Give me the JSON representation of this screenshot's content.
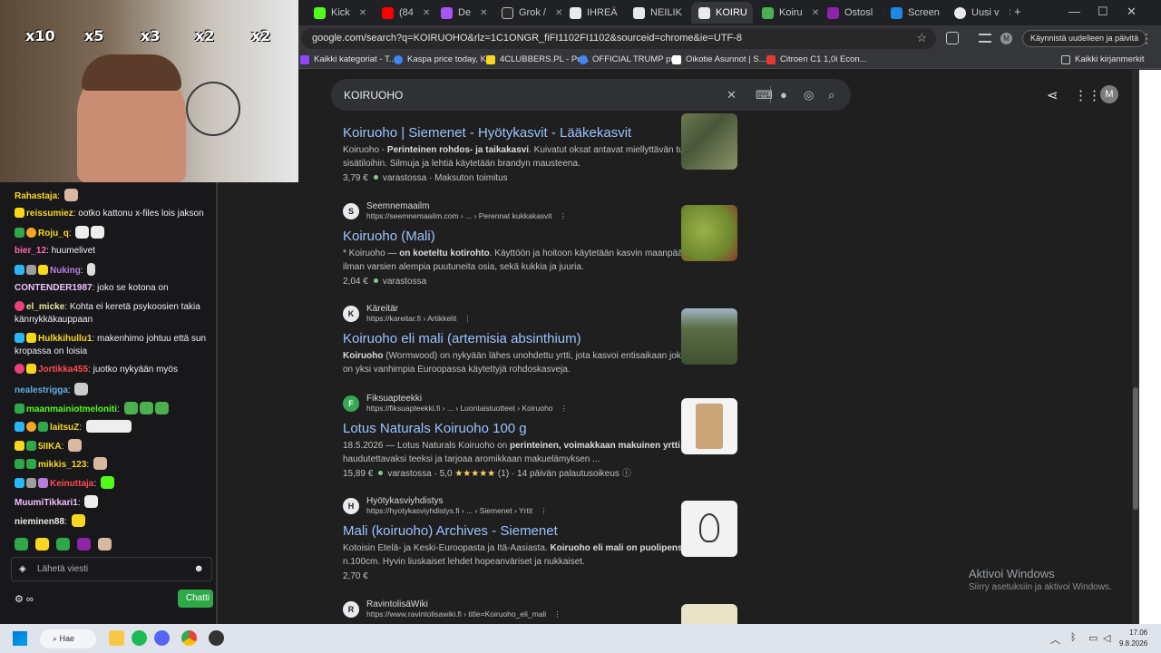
{
  "browser": {
    "tabs": [
      {
        "label": "Kick",
        "color": "#53fc18"
      },
      {
        "label": "(84",
        "color": "#ff0000"
      },
      {
        "label": "De",
        "color": "#a855f7"
      },
      {
        "label": "Grok /",
        "color": "#ffffff"
      },
      {
        "label": "IHREÄ",
        "color": "#ffffff"
      },
      {
        "label": "NEILIK",
        "color": "#ffffff"
      },
      {
        "label": "KOIRU",
        "color": "#ffffff"
      },
      {
        "label": "Koiru",
        "color": "#4caf50"
      },
      {
        "label": "Ostosl",
        "color": "#8e24aa"
      },
      {
        "label": "Screen",
        "color": "#1e88e5"
      },
      {
        "label": "Uusi v",
        "color": "#ffffff"
      }
    ],
    "url": "google.com/search?q=KOIRUOHO&rlz=1C1ONGR_fiFI1102FI1102&sourceid=chrome&ie=UTF-8",
    "profile_initial": "M",
    "restart_label": "Käynnistä uudelleen ja päivitä",
    "bookmarks": [
      {
        "label": "Kaikki kategoriat - T...",
        "color": "#9146ff"
      },
      {
        "label": "Kaspa price today, K...",
        "color": "#4285f4"
      },
      {
        "label": "4CLUBBERS.PL - Po...",
        "color": "#f9d71c"
      },
      {
        "label": "OFFICIAL TRUMP pr...",
        "color": "#4285f4"
      },
      {
        "label": "Oikotie Asunnot | S...",
        "color": "#ffffff"
      },
      {
        "label": "Citroen C1 1,0i Econ...",
        "color": "#e53935"
      }
    ],
    "all_bookmarks": "Kaikki kirjanmerkit"
  },
  "search": {
    "query": "KOIRUOHO",
    "user_initial": "M",
    "results": [
      {
        "site": "",
        "url": "",
        "title": "Koiruoho | Siemenet - Hyötykasvit - Lääkekasvit",
        "snippet_html": "Koiruoho - <b>Perinteinen rohdos- ja taikakasvi</b>. Kuivatut oksat antavat miellyttävän tuoksun sisätiloihin. Silmuja ja lehtiä käytetään brandyn mausteena.",
        "price": "3,79 €",
        "stock": "varastossa",
        "extra": "Maksuton toimitus",
        "thumb_color": "#6e7a4f"
      },
      {
        "site": "Seemnemaailm",
        "url": "https://seemnemaailm.com › ... › Perennat kukkakasvit",
        "title": "Koiruoho (Mali)",
        "snippet_html": "* Koiruoho — <b>on koeteltu kotirohto</b>. Käyttöön ja hoitoon käytetään kasvin maanpäällistä osaa ilman varsien alempia puutuneita osia, sekä kukkia ja juuria.",
        "price": "2,04 €",
        "stock": "varastossa",
        "extra": "",
        "thumb_color": "#7f9a3a"
      },
      {
        "site": "Käreitär",
        "url": "https://kareitar.fi › Artikkelit",
        "title": "Koiruoho eli mali (artemisia absinthium)",
        "snippet_html": "<b>Koiruoho</b> (Wormwood) on nykyään lähes unohdettu yrtti, jota kasvoi entisaikaan joka pihassa. Se on yksi vanhimpia Euroopassa käytettyjä rohdoskasveja.",
        "price": "",
        "stock": "",
        "extra": "",
        "thumb_color": "#5b6e45"
      },
      {
        "site": "Fiksuapteekki",
        "url": "https://fiksuapteekki.fi › ... › Luontaistuotteet › Koiruoho",
        "title": "Lotus Naturals Koiruoho 100 g",
        "snippet_html": "18.5.2026 — Lotus Naturals Koiruoho on <b>perinteinen, voimakkaan makuinen yrtti</b>. Se sopii haudutettavaksi teeksi ja tarjoaa aromikkaan makuelämyksen ...",
        "price": "15,89 €",
        "stock": "varastossa",
        "rating": "5,0",
        "stars": "★★★★★",
        "reviews": "(1)",
        "extra": "14 päivän palautusoikeus",
        "thumb_color": "#c9a577"
      },
      {
        "site": "Hyötykasviyhdistys",
        "url": "https://hyotykasviyhdistys.fi › ... › Siemenet › Yrtit",
        "title": "Mali (koiruoho) Archives - Siemenet",
        "snippet_html": "Kotoisin Etelä- ja Keski-Euroopasta ja Itä-Aasiasta. <b>Koiruoho eli mali on puolipensas</b>. Korkeus n.100cm. Hyvin liuskaiset lehdet hopeanväriset ja nukkaiset.",
        "price": "2,70 €",
        "stock": "",
        "extra": "",
        "thumb_color": "#f2f2f2"
      },
      {
        "site": "RavintolisäWiki",
        "url": "https://www.ravintolisawiki.fi › title=Koiruoho_eli_mali",
        "title": "",
        "snippet_html": "",
        "price": "",
        "stock": "",
        "extra": "",
        "thumb_color": "#e8e3c6"
      }
    ]
  },
  "windows_watermark": {
    "line1": "Aktivoi Windows",
    "line2": "Siirry asetuksiin ja aktivoi Windows."
  },
  "stream": {
    "multipliers": [
      "x10",
      "x5",
      "x3",
      "x2",
      "x2"
    ],
    "chat": [
      {
        "user": "Rahastaja",
        "color": "#f9d71c",
        "text": ""
      },
      {
        "user": "reissumiez",
        "color": "#f9d71c",
        "text": "ootko kattonu x-files lois jakson"
      },
      {
        "user": "Roju_q",
        "color": "#f9d71c",
        "text": ""
      },
      {
        "user": "bier_12",
        "color": "#ff69b4",
        "text": "huumelivet"
      },
      {
        "user": "Nuking",
        "color": "#b57edc",
        "text": ""
      },
      {
        "user": "CONTENDER1987",
        "color": "#f0c0ff",
        "text": "joko se kotona on"
      },
      {
        "user": "el_micke",
        "color": "#e8e8a0",
        "text": "Kohta ei keretä psykoosien takia"
      },
      {
        "user": "",
        "color": "#efeff1",
        "text": "kännykkäkauppaan"
      },
      {
        "user": "Hulkkihullu1",
        "color": "#f9d71c",
        "text": "makenhimo johtuu että sun"
      },
      {
        "user": "",
        "color": "#efeff1",
        "text": "kropassa on loisia"
      },
      {
        "user": "Jortikka455",
        "color": "#ff4d4d",
        "text": "juotko nykyään myös"
      },
      {
        "user": "nealestrigga",
        "color": "#5dade2",
        "text": ""
      },
      {
        "user": "maanmainiotmeloniti",
        "color": "#53fc18",
        "text": ""
      },
      {
        "user": "laitsuZ",
        "color": "#f9d71c",
        "text": ""
      },
      {
        "user": "5IIKA",
        "color": "#f9d71c",
        "text": ""
      },
      {
        "user": "mikkis_123",
        "color": "#f9d71c",
        "text": ""
      },
      {
        "user": "Keinuttaja",
        "color": "#ff4d4d",
        "text": ""
      },
      {
        "user": "MuumiTikkari1",
        "color": "#f0c0ff",
        "text": ""
      },
      {
        "user": "nieminen88",
        "color": "#e8e8e8",
        "text": ""
      }
    ],
    "input_placeholder": "Lähetä viesti",
    "send_label": "Chatti"
  },
  "taskbar": {
    "search_label": "Hae",
    "time": "17.06",
    "date": "9.8.2026"
  }
}
